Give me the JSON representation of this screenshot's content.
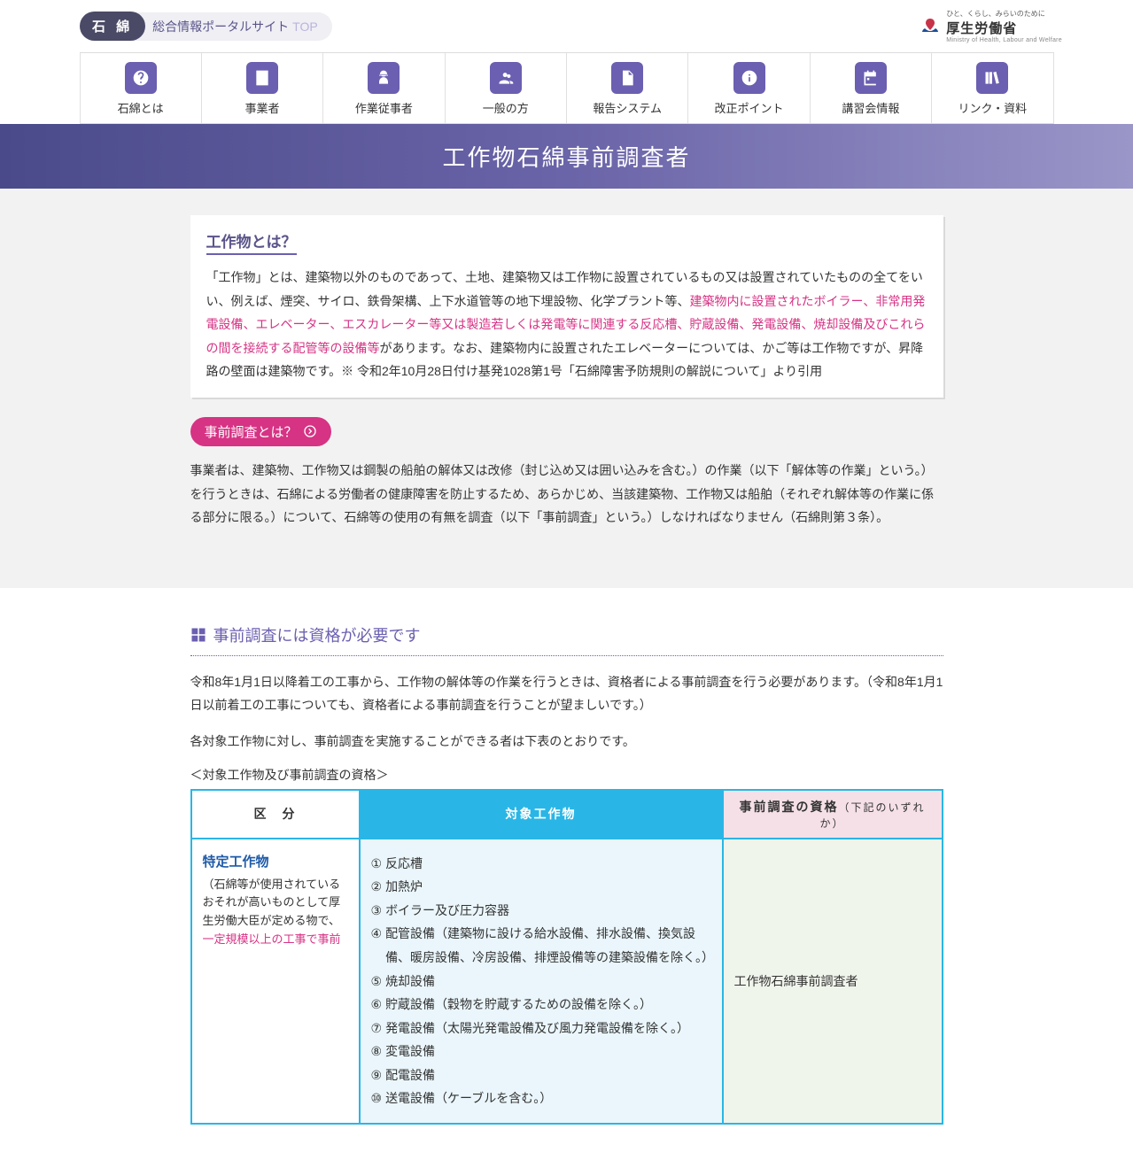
{
  "site_badge": {
    "tag": "石 綿",
    "label": "総合情報ポータルサイト",
    "top": "TOP"
  },
  "mhlw": {
    "tagline": "ひと、くらし、みらいのために",
    "name": "厚生労働省",
    "sub": "Ministry of Health, Labour and Welfare"
  },
  "nav": [
    {
      "label": "石綿とは",
      "icon": "question"
    },
    {
      "label": "事業者",
      "icon": "building"
    },
    {
      "label": "作業従事者",
      "icon": "worker"
    },
    {
      "label": "一般の方",
      "icon": "people"
    },
    {
      "label": "報告システム",
      "icon": "document"
    },
    {
      "label": "改正ポイント",
      "icon": "info"
    },
    {
      "label": "講習会情報",
      "icon": "calendar"
    },
    {
      "label": "リンク・資料",
      "icon": "books"
    }
  ],
  "hero": {
    "title": "工作物石綿事前調査者"
  },
  "def": {
    "title": "工作物とは？",
    "p1a": "「工作物」とは、建築物以外のものであって、土地、建築物又は工作物に設置されているもの又は設置されていたものの全てをいい、例えば、煙突、サイロ、鉄骨架構、上下水道管等の地下埋設物、化学プラント等、",
    "p1hl": "建築物内に設置されたボイラー、非常用発電設備、エレベーター、エスカレーター等又は製造若しくは発電等に関連する反応槽、貯蔵設備、発電設備、焼却設備及びこれらの間を接続する配管等の設備等",
    "p1b": "があります。なお、建築物内に設置されたエレベーターについては、かご等は工作物ですが、昇降路の壁面は建築物です。※ 令和2年10月28日付け基発1028第1号「石綿障害予防規則の解説について」より引用"
  },
  "pre": {
    "heading": "事前調査とは？",
    "text": "事業者は、建築物、工作物又は鋼製の船舶の解体又は改修（封じ込め又は囲い込みを含む。）の作業（以下「解体等の作業」という。）を行うときは、石綿による労働者の健康障害を防止するため、あらかじめ、当該建築物、工作物又は船舶（それぞれ解体等の作業に係る部分に限る。）について、石綿等の使用の有無を調査（以下「事前調査」という。）しなければなりません（石綿則第３条）。"
  },
  "sec": {
    "heading": "事前調査には資格が必要です",
    "p1": "令和8年1月1日以降着工の工事から、工作物の解体等の作業を行うときは、資格者による事前調査を行う必要があります。（令和8年1月1日以前着工の工事についても、資格者による事前調査を行うことが望ましいです。）",
    "p2": "各対象工作物に対し、事前調査を実施することができる者は下表のとおりです。",
    "caption": "＜対象工作物及び事前調査の資格＞"
  },
  "table": {
    "th1": "区　分",
    "th2": "対象工作物",
    "th3": "事前調査の資格",
    "th3note": "（下記のいずれか）",
    "row1": {
      "cat_title": "特定工作物",
      "cat_note_a": "（石綿等が使用されているおそれが高いものとして厚生労働大臣が定める物で、",
      "cat_note_hl": "一定規模以上の工事で事前",
      "items": [
        "反応槽",
        "加熱炉",
        "ボイラー及び圧力容器",
        "配管設備（建築物に設ける給水設備、排水設備、換気設備、暖房設備、冷房設備、排煙設備等の建築設備を除く。）",
        "焼却設備",
        "貯蔵設備（穀物を貯蔵するための設備を除く。）",
        "発電設備（太陽光発電設備及び風力発電設備を除く。）",
        "変電設備",
        "配電設備",
        "送電設備（ケーブルを含む。）"
      ],
      "qual": "工作物石綿事前調査者"
    }
  }
}
